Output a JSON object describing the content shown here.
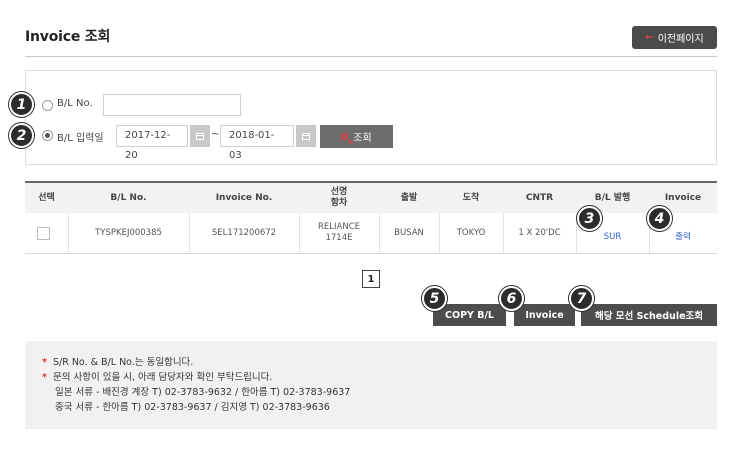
{
  "header": {
    "title": "Invoice 조회",
    "back_arrow": "←",
    "back_label": "이전페이지"
  },
  "search": {
    "bl_radio_label": "B/L No.",
    "bl_input_value": "",
    "date_radio_label": "B/L 입력일",
    "date_from": "2017-12-20",
    "date_sep": "~",
    "date_to": "2018-01-03",
    "search_label": "조회"
  },
  "badges": [
    "1",
    "2",
    "3",
    "4",
    "5",
    "6",
    "7"
  ],
  "table": {
    "headers": {
      "select": "선택",
      "bl_no": "B/L No.",
      "invoice_no": "Invoice No.",
      "vessel_1": "선명",
      "vessel_2": "항차",
      "departure": "출발",
      "arrival": "도착",
      "cntr": "CNTR",
      "bl_issue": "B/L 발행",
      "invoice": "Invoice"
    },
    "rows": [
      {
        "bl_no": "TYSPKEJ000385",
        "invoice_no": "SEL171200672",
        "vessel_1": "RELIANCE",
        "vessel_2": "1714E",
        "departure": "BUSAN",
        "arrival": "TOKYO",
        "cntr": "1 X 20'DC",
        "bl_issue": "SUR",
        "invoice": "출력"
      }
    ]
  },
  "pagination": {
    "current": "1"
  },
  "actions": {
    "copy_bl": "COPY B/L",
    "invoice": "Invoice",
    "schedule": "해당 모선 Schedule조회"
  },
  "notice": {
    "star": "*",
    "line1": "S/R No. & B/L No.는 동일합니다.",
    "line2": "문의 사항이 있을 시, 아래 담당자와 확인 부탁드립니다.",
    "line3": "일본 서류 - 배진경 계장 T) 02-3783-9632 / 한아름 T) 02-3783-9637",
    "line4": "중국 서류 - 한아름 T) 02-3783-9637 / 김지영 T) 02-3783-9636"
  },
  "colors": {
    "dark_button": "#4d4d4d",
    "accent_red": "#e23b3b",
    "link_blue": "#2f5fd0",
    "notice_bg": "#f1f1f1"
  }
}
